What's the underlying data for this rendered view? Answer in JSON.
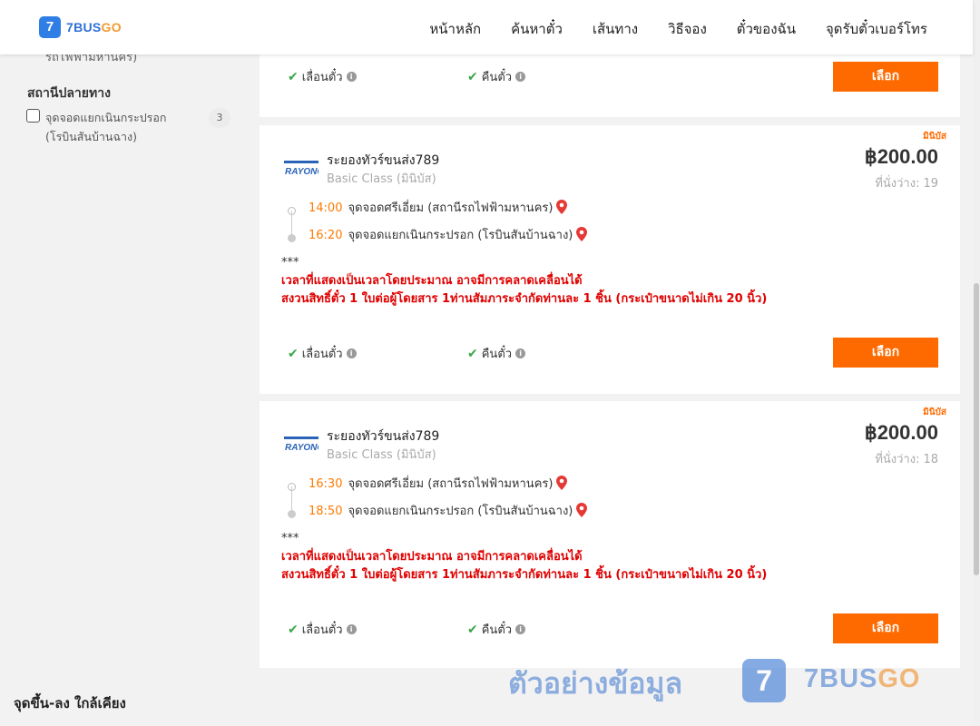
{
  "header": {
    "logo_mark": "7",
    "logo_text_a": "7BUS",
    "logo_text_b": "GO",
    "nav": [
      "หน้าหลัก",
      "ค้นหาตั๋ว",
      "เส้นทาง",
      "วิธีจอง",
      "ตั๋วของฉัน",
      "จุดรับตั๋วเบอร์โทร"
    ]
  },
  "sidebar": {
    "cut_text": "รถไฟฟ้ามหานคร)",
    "destination_heading": "สถานีปลายทาง",
    "filter": {
      "label": "จุดจอดแยกเนินกระปรอก (โรบินสันบ้านฉาง)",
      "count": "3"
    },
    "nearby_heading": "จุดขึ้น-ลง ใกล้เคียง"
  },
  "top_card": {
    "reschedule": "เลื่อนตั๋ว",
    "refund": "คืนตั๋ว",
    "select": "เลือก"
  },
  "trips": [
    {
      "bus_type": "มินิบัส",
      "operator": "ระยองทัวร์ขนส่ง789",
      "class": "Basic Class (มินิบัส)",
      "price": "฿200.00",
      "seats_label": "ที่นั่งว่าง:",
      "seats": "19",
      "depart_time": "14:00",
      "depart_stop": "จุดจอดศรีเอี่ยม (สถานีรถไฟฟ้ามหานคร)",
      "arrive_time": "16:20",
      "arrive_stop": "จุดจอดแยกเนินกระปรอก (โรบินสันบ้านฉาง)",
      "note_stars": "***",
      "warning_1": "เวลาที่แสดงเป็นเวลาโดยประมาณ อาจมีการคลาดเคลื่อนได้",
      "warning_2": "สงวนสิทธิ์ตั๋ว 1 ใบต่อผู้โดยสาร 1ท่านสัมภาระจำกัดท่านละ 1 ชิ้น (กระเป๋าขนาดไม่เกิน 20 นิ้ว)",
      "reschedule": "เลื่อนตั๋ว",
      "refund": "คืนตั๋ว",
      "select": "เลือก"
    },
    {
      "bus_type": "มินิบัส",
      "operator": "ระยองทัวร์ขนส่ง789",
      "class": "Basic Class (มินิบัส)",
      "price": "฿200.00",
      "seats_label": "ที่นั่งว่าง:",
      "seats": "18",
      "depart_time": "16:30",
      "depart_stop": "จุดจอดศรีเอี่ยม (สถานีรถไฟฟ้ามหานคร)",
      "arrive_time": "18:50",
      "arrive_stop": "จุดจอดแยกเนินกระปรอก (โรบินสันบ้านฉาง)",
      "note_stars": "***",
      "warning_1": "เวลาที่แสดงเป็นเวลาโดยประมาณ อาจมีการคลาดเคลื่อนได้",
      "warning_2": "สงวนสิทธิ์ตั๋ว 1 ใบต่อผู้โดยสาร 1ท่านสัมภาระจำกัดท่านละ 1 ชิ้น (กระเป๋าขนาดไม่เกิน 20 นิ้ว)",
      "reschedule": "เลื่อนตั๋ว",
      "refund": "คืนตั๋ว",
      "select": "เลือก"
    }
  ],
  "operator_logo_text": "RAYONG",
  "watermark": {
    "text": "ตัวอย่างข้อมูล",
    "logo_mark": "7",
    "brand_a": "7BUS",
    "brand_b": "GO"
  },
  "colors": {
    "accent": "#ff6a00",
    "warning": "#e00000",
    "time": "#ff7a00",
    "check": "#3aa64a"
  }
}
